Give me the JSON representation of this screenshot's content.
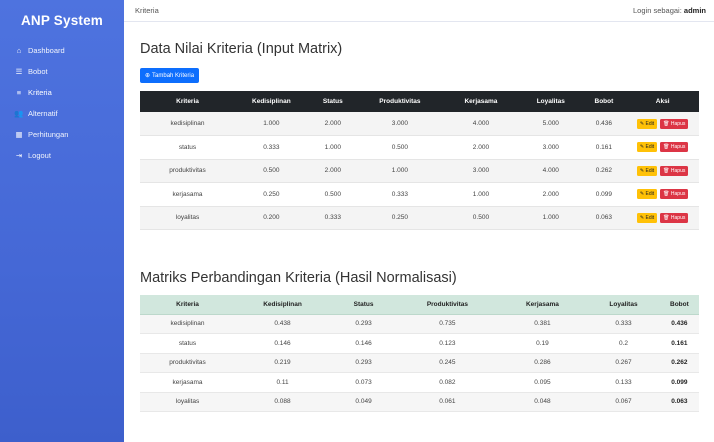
{
  "brand": "ANP System",
  "nav": [
    {
      "icon": "home-icon",
      "glyph": "⌂",
      "label": "Dashboard"
    },
    {
      "icon": "list-icon",
      "glyph": "☰",
      "label": "Bobot"
    },
    {
      "icon": "list-lines-icon",
      "glyph": "≡",
      "label": "Kriteria"
    },
    {
      "icon": "users-icon",
      "glyph": "👥",
      "label": "Alternatif"
    },
    {
      "icon": "calculator-icon",
      "glyph": "▦",
      "label": "Perhitungan"
    },
    {
      "icon": "logout-icon",
      "glyph": "⇥",
      "label": "Logout"
    }
  ],
  "topbar": {
    "page": "Kriteria",
    "login_prefix": "Login sebagai:",
    "user": "admin"
  },
  "section1": {
    "title": "Data Nilai Kriteria (Input Matrix)",
    "add_button": "Tambah Kriteria",
    "headers": [
      "Kriteria",
      "Kedisiplinan",
      "Status",
      "Produktivitas",
      "Kerjasama",
      "Loyalitas",
      "Bobot",
      "Aksi"
    ],
    "edit_label": "Edit",
    "delete_label": "Hapus",
    "rows": [
      [
        "kedisiplinan",
        "1.000",
        "2.000",
        "3.000",
        "4.000",
        "5.000",
        "0.436"
      ],
      [
        "status",
        "0.333",
        "1.000",
        "0.500",
        "2.000",
        "3.000",
        "0.161"
      ],
      [
        "produktivitas",
        "0.500",
        "2.000",
        "1.000",
        "3.000",
        "4.000",
        "0.262"
      ],
      [
        "kerjasama",
        "0.250",
        "0.500",
        "0.333",
        "1.000",
        "2.000",
        "0.099"
      ],
      [
        "loyalitas",
        "0.200",
        "0.333",
        "0.250",
        "0.500",
        "1.000",
        "0.063"
      ]
    ]
  },
  "section2": {
    "title": "Matriks Perbandingan Kriteria (Hasil Normalisasi)",
    "headers": [
      "Kriteria",
      "Kedisiplinan",
      "Status",
      "Produktivitas",
      "Kerjasama",
      "Loyalitas",
      "Bobot"
    ],
    "rows": [
      [
        "kedisiplinan",
        "0.438",
        "0.293",
        "0.735",
        "0.381",
        "0.333",
        "0.436"
      ],
      [
        "status",
        "0.146",
        "0.146",
        "0.123",
        "0.19",
        "0.2",
        "0.161"
      ],
      [
        "produktivitas",
        "0.219",
        "0.293",
        "0.245",
        "0.286",
        "0.267",
        "0.262"
      ],
      [
        "kerjasama",
        "0.11",
        "0.073",
        "0.082",
        "0.095",
        "0.133",
        "0.099"
      ],
      [
        "loyalitas",
        "0.088",
        "0.049",
        "0.061",
        "0.048",
        "0.067",
        "0.063"
      ]
    ]
  },
  "colors": {
    "sidebar": "#4e73df",
    "primary": "#0d6efd",
    "edit": "#ffc107",
    "delete": "#dc3545",
    "table_dark": "#212529",
    "table_success": "#d1e7dd"
  }
}
